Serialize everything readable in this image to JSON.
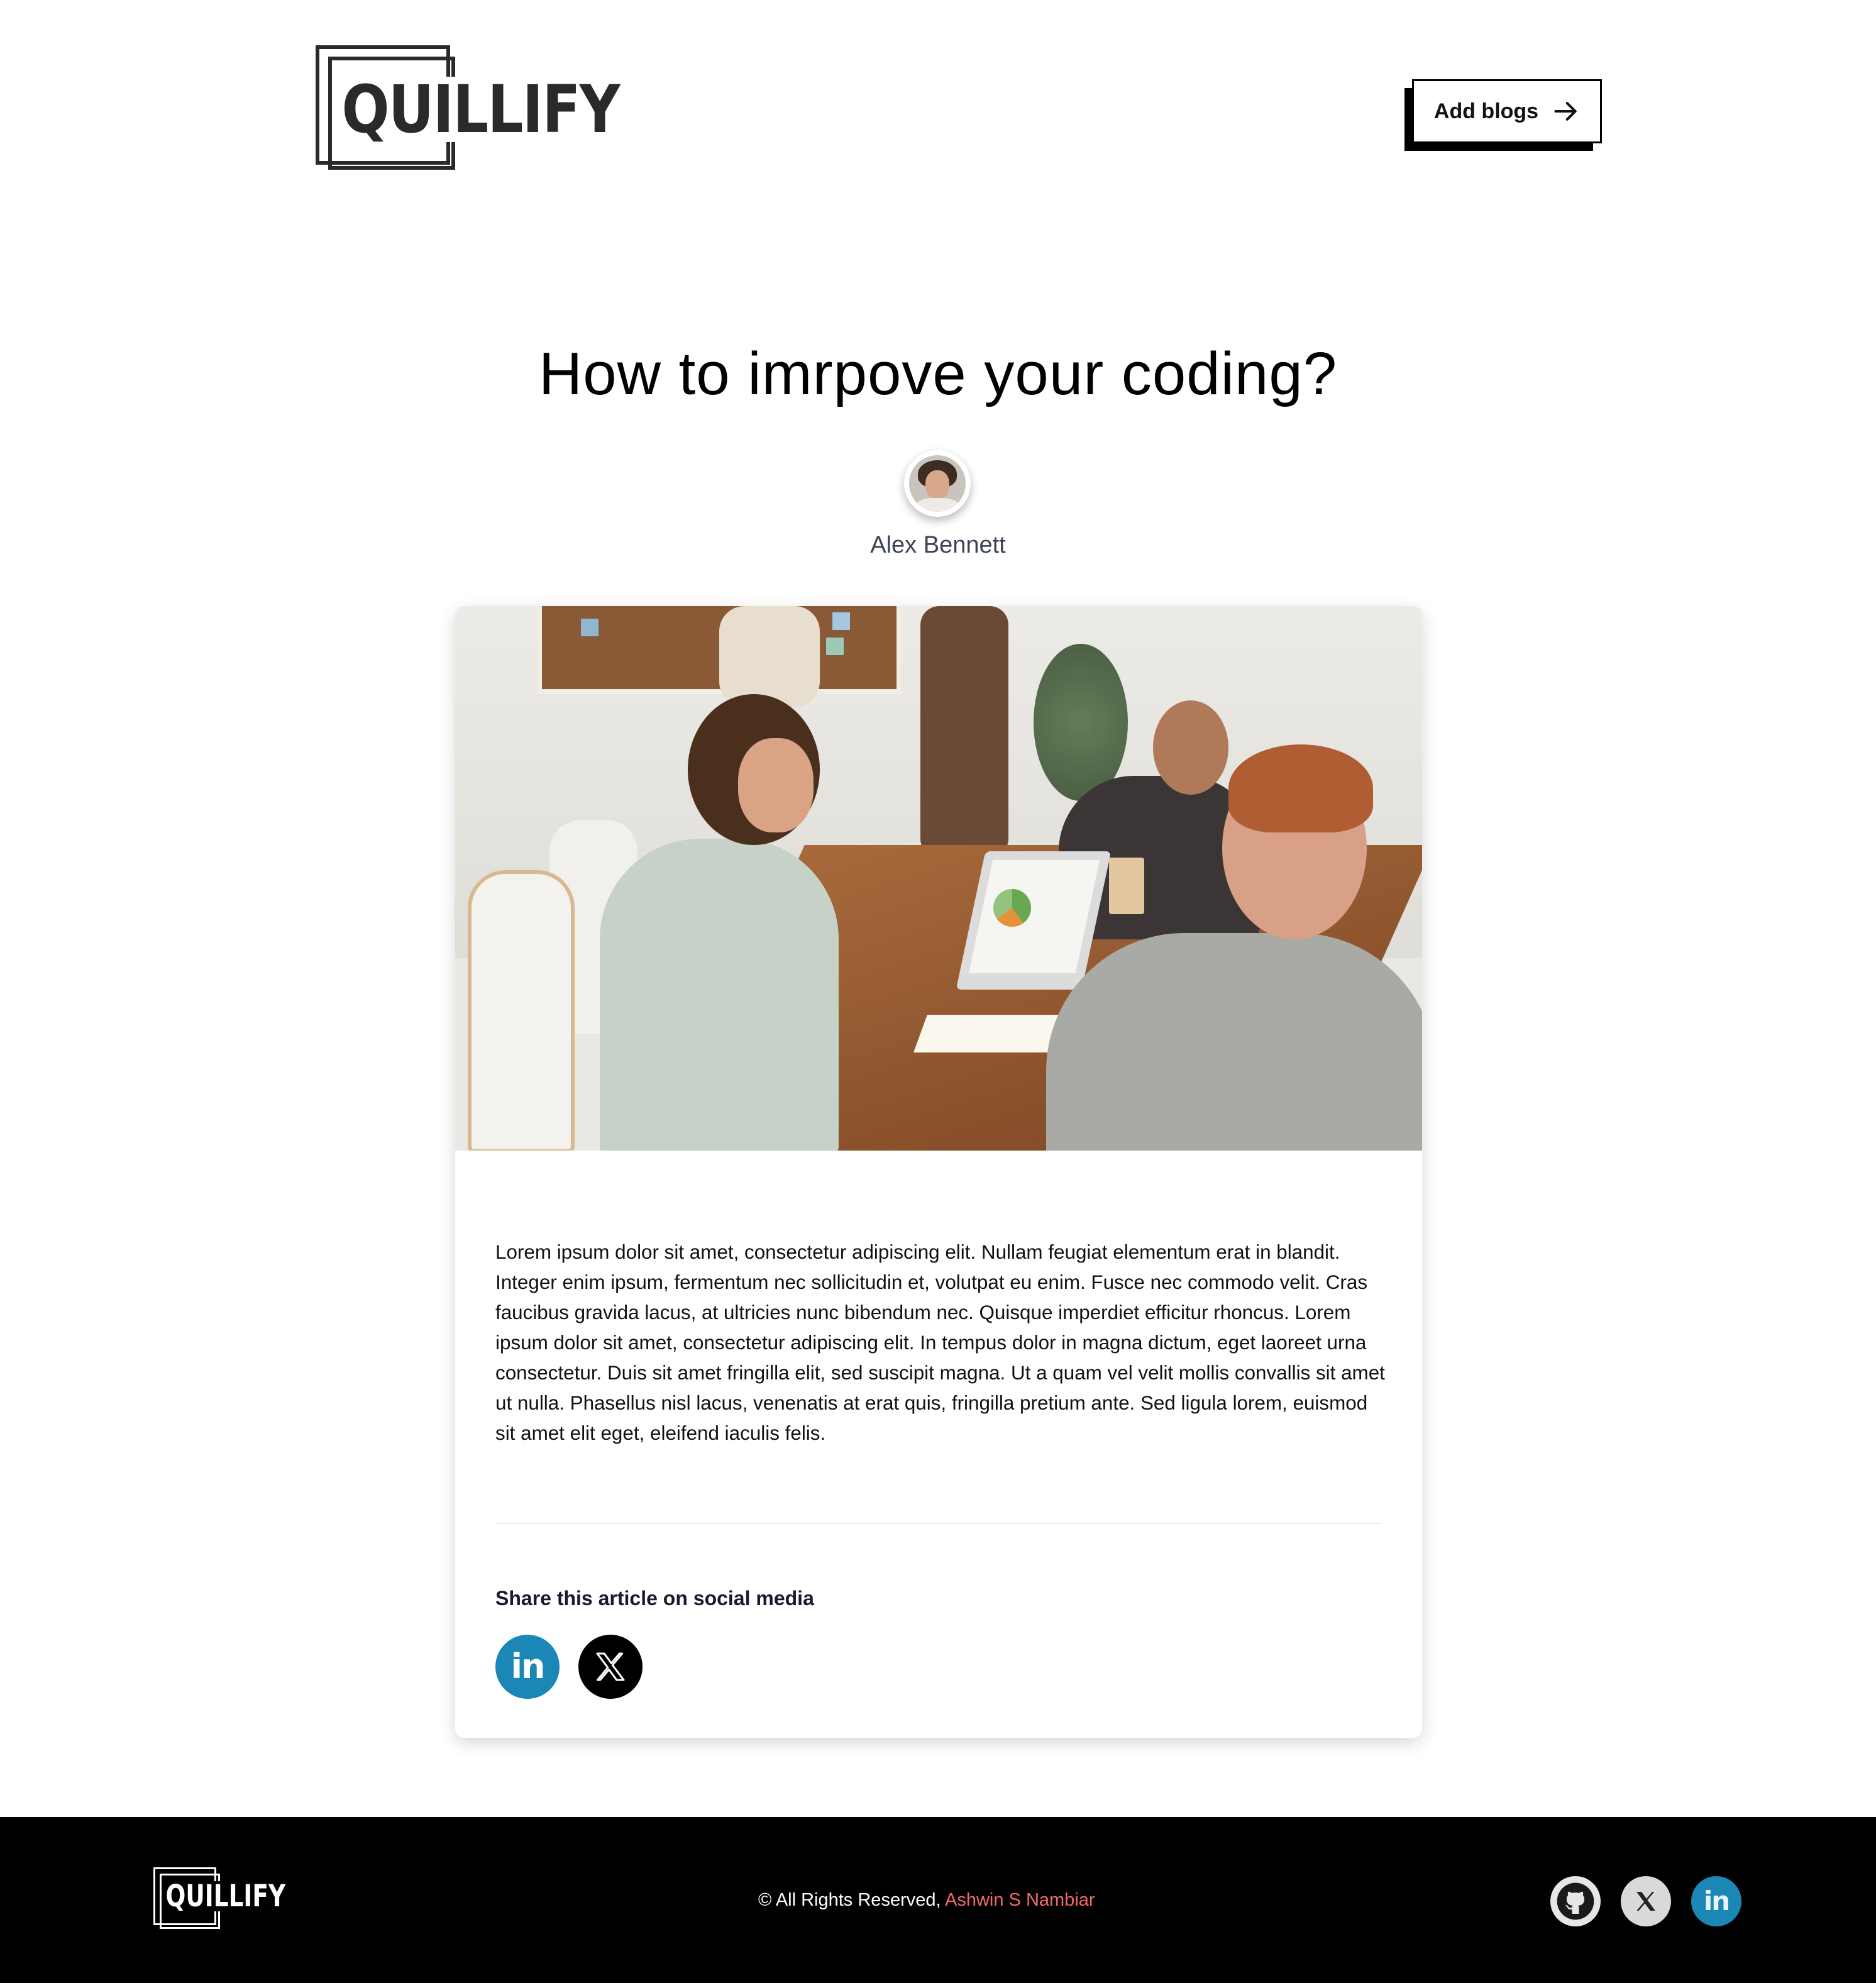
{
  "header": {
    "logo_text": "QUILLIFY",
    "add_button_label": "Add blogs"
  },
  "article": {
    "title": "How to imrpove your coding?",
    "author": "Alex Bennett",
    "body": "Lorem ipsum dolor sit amet, consectetur adipiscing elit. Nullam feugiat elementum erat in blandit. Integer enim ipsum, fermentum nec sollicitudin et, volutpat eu enim. Fusce nec commodo velit. Cras faucibus gravida lacus, at ultricies nunc bibendum nec. Quisque imperdiet efficitur rhoncus. Lorem ipsum dolor sit amet, consectetur adipiscing elit. In tempus dolor in magna dictum, eget laoreet urna consectetur. Duis sit amet fringilla elit, sed suscipit magna. Ut a quam vel velit mollis convallis sit amet ut nulla. Phasellus nisl lacus, venenatis at erat quis, fringilla pretium ante. Sed ligula lorem, euismod sit amet elit eget, eleifend iaculis felis.",
    "share_title": "Share this article on social media",
    "share_icons": [
      "linkedin-icon",
      "x-icon"
    ]
  },
  "footer": {
    "logo_text": "QUILLIFY",
    "copyright_prefix": "© All Rights Reserved,",
    "copyright_name": "Ashwin S Nambiar",
    "icons": [
      "github-icon",
      "x-icon",
      "linkedin-icon"
    ]
  },
  "colors": {
    "linkedin": "#1b87b7",
    "x": "#000000",
    "author_link": "#f26b6b",
    "footer_bg": "#000000"
  }
}
